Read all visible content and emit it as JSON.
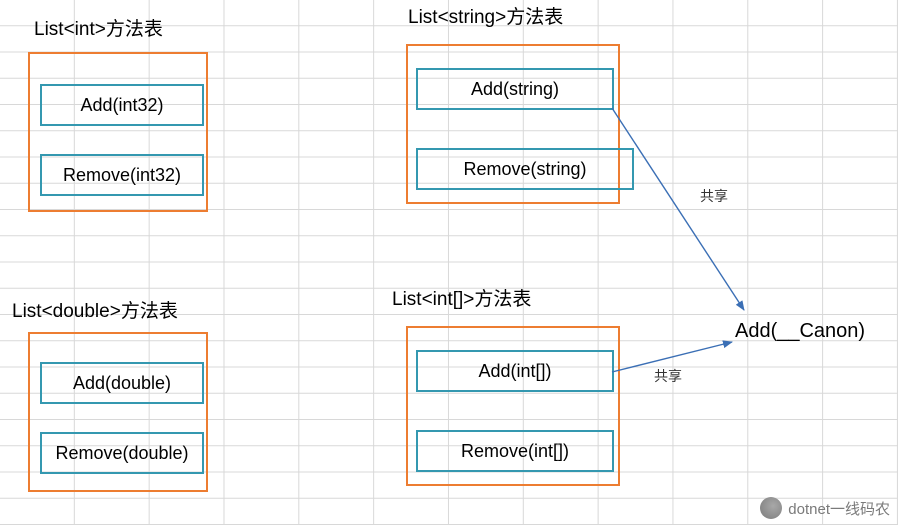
{
  "tables": {
    "int": {
      "title": "List<int>方法表",
      "methods": [
        "Add(int32)",
        "Remove(int32)"
      ]
    },
    "double": {
      "title": "List<double>方法表",
      "methods": [
        "Add(double)",
        "Remove(double)"
      ]
    },
    "string": {
      "title": "List<string>方法表",
      "methods": [
        "Add(string)",
        "Remove(string)"
      ]
    },
    "intarr": {
      "title": "List<int[]>方法表",
      "methods": [
        "Add(int[])",
        "Remove(int[])"
      ]
    }
  },
  "shared": {
    "target": "Add(__Canon)",
    "label1": "共享",
    "label2": "共享"
  },
  "watermark": "dotnet一线码农"
}
